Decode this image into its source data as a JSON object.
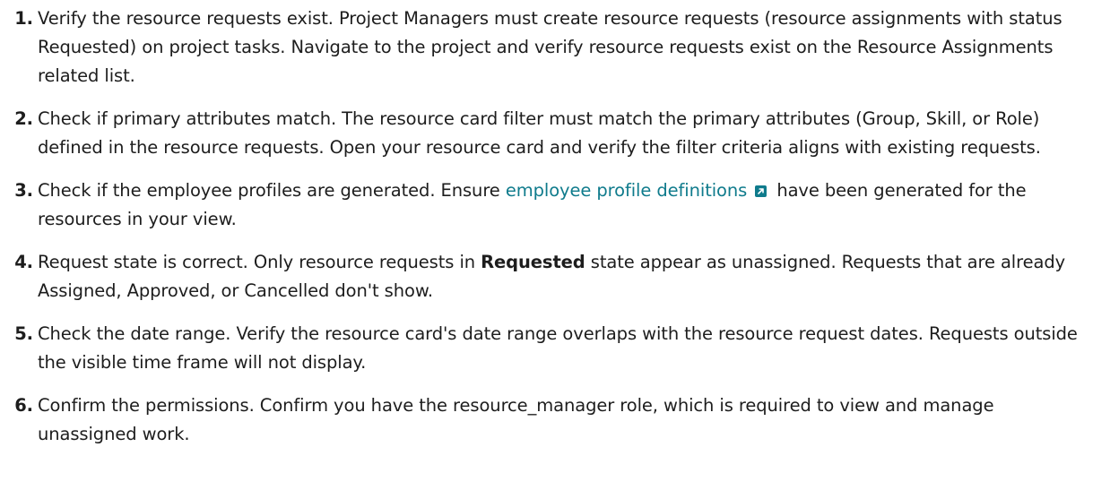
{
  "steps": [
    {
      "number": "1.",
      "text": "Verify the resource requests exist. Project Managers must create resource requests (resource assignments with status Requested) on project tasks. Navigate to the project and verify resource requests exist on the Resource Assignments related list."
    },
    {
      "number": "2.",
      "text": "Check if primary attributes match. The resource card filter must match the primary attributes (Group, Skill, or Role) defined in the resource requests. Open your resource card and verify the filter criteria aligns with existing requests."
    },
    {
      "number": "3.",
      "text_before": "Check if the employee profiles are generated. Ensure ",
      "link_text": "employee profile definitions",
      "text_after": " have been generated for the resources in your view."
    },
    {
      "number": "4.",
      "text_before": "Request state is correct. Only resource requests in ",
      "bold_text": "Requested",
      "text_after": " state appear as unassigned. Requests that are already Assigned, Approved, or Cancelled don't show."
    },
    {
      "number": "5.",
      "text": "Check the date range. Verify the resource card's date range overlaps with the resource request dates. Requests outside the visible time frame will not display."
    },
    {
      "number": "6.",
      "text": "Confirm the permissions. Confirm you have the resource_manager role, which is required to view and manage unassigned work."
    }
  ],
  "icons": {
    "external_link": "external-link-icon"
  },
  "colors": {
    "text": "#1d1d1d",
    "link": "#0f7b8c"
  }
}
